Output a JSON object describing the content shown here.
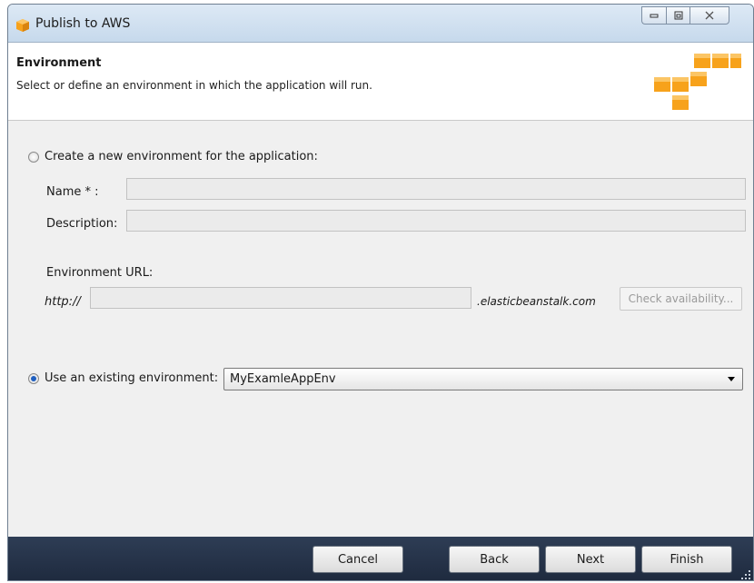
{
  "window": {
    "title": "Publish to AWS",
    "title_icon": "aws-cube-icon",
    "controls": [
      "minimize-icon",
      "maximize-icon",
      "close-icon"
    ]
  },
  "header": {
    "title": "Environment",
    "subtitle": "Select or define an environment in which the application will run.",
    "logo": "aws-logo"
  },
  "create_new": {
    "label": "Create a new environment for the application:",
    "selected": false,
    "name_label": "Name * :",
    "name_value": "",
    "description_label": "Description:",
    "description_value": "",
    "url_label": "Environment URL:",
    "url_prefix": "http://",
    "url_value": "",
    "url_suffix": ".elasticbeanstalk.com",
    "check_button": "Check availability..."
  },
  "use_existing": {
    "label": "Use an existing environment:",
    "selected": true,
    "selected_value": "MyExamleAppEnv"
  },
  "footer": {
    "cancel": "Cancel",
    "back": "Back",
    "next": "Next",
    "finish": "Finish"
  },
  "colors": {
    "footer_bg": "#26344a",
    "aws_orange": "#f7a21b",
    "radio_accent": "#1f5fbf"
  }
}
